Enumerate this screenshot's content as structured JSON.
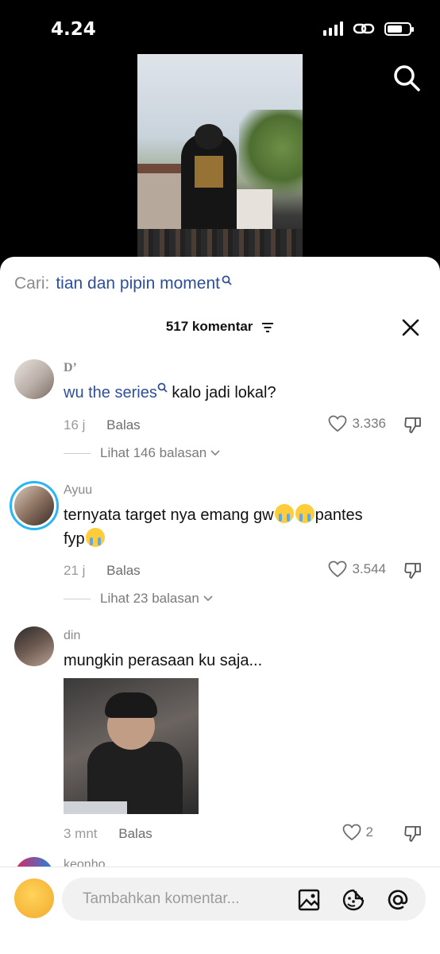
{
  "status_bar": {
    "time": "4.24"
  },
  "search": {
    "label": "Cari:",
    "term": "tian dan pipin moment"
  },
  "comments_header": {
    "count_label": "517 komentar"
  },
  "comments": [
    {
      "username": "D’",
      "link_text": "wu the series",
      "text": "kalo jadi lokal?",
      "time": "16 j",
      "reply_label": "Balas",
      "likes": "3.336",
      "view_replies": "Lihat 146 balasan"
    },
    {
      "username": "Ayuu",
      "text_line1": "ternyata target nya emang gw",
      "text_line1_tail": "pantes",
      "text_line2": "fyp",
      "time": "21 j",
      "reply_label": "Balas",
      "likes": "3.544",
      "view_replies": "Lihat 23 balasan"
    },
    {
      "username": "din",
      "text": "mungkin perasaan ku saja...",
      "time": "3 mnt",
      "reply_label": "Balas",
      "likes": "2"
    },
    {
      "username": "keonho"
    }
  ],
  "composer": {
    "placeholder": "Tambahkan komentar..."
  },
  "icons": {
    "search": "search-icon",
    "close": "close-icon",
    "filter": "filter-icon",
    "heart": "heart-icon",
    "dislike": "dislike-icon",
    "image": "image-icon",
    "sticker": "sticker-icon",
    "mention": "at-icon"
  },
  "colors": {
    "link": "#2d4f9a",
    "story_ring": "#29b6f6"
  }
}
